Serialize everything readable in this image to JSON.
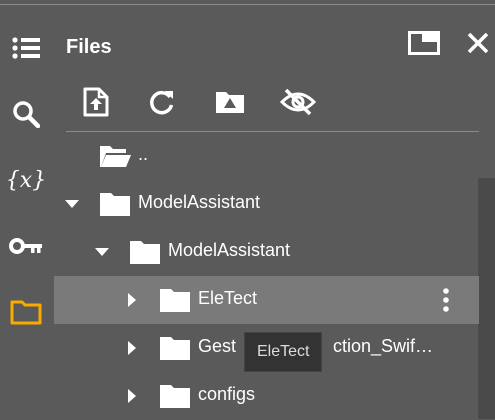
{
  "panel": {
    "title": "Files"
  },
  "rail": [
    {
      "name": "table-of-contents-icon"
    },
    {
      "name": "search-icon"
    },
    {
      "name": "variables-icon",
      "text": "{x}"
    },
    {
      "name": "key-icon"
    },
    {
      "name": "folder-icon",
      "active": true
    }
  ],
  "header": {
    "buttons": [
      "open-in-window-icon",
      "close-icon"
    ]
  },
  "toolbar": [
    "upload-icon",
    "refresh-icon",
    "mount-drive-icon",
    "hide-hidden-files-icon"
  ],
  "tree": {
    "parent_label": "..",
    "rows": [
      {
        "label": "ModelAssistant",
        "expanded": true
      },
      {
        "label": "ModelAssistant",
        "expanded": true
      },
      {
        "label": "EleTect",
        "expanded": false,
        "selected": true
      },
      {
        "label": "GestureDetection_Swif…",
        "visible_prefix": "Gest",
        "visible_suffix": "ction_Swif…",
        "expanded": false
      },
      {
        "label": "configs",
        "expanded": false
      }
    ]
  },
  "tooltip": {
    "text": "EleTect"
  },
  "colors": {
    "background": "#5a5a5a",
    "selected_row": "#7a7a7a",
    "active_icon": "#f9ab00",
    "icon": "#ffffff",
    "tooltip_bg": "#333333"
  }
}
